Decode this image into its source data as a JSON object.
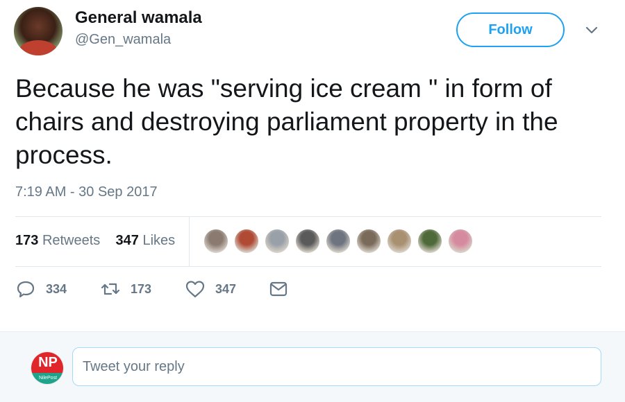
{
  "author": {
    "name": "General wamala",
    "handle": "@Gen_wamala"
  },
  "follow_label": "Follow",
  "tweet": {
    "text": "Because he was \"serving ice cream \" in form of chairs and destroying parliament property in the process.",
    "timestamp": "7:19 AM - 30 Sep 2017"
  },
  "stats": {
    "retweets_count": "173",
    "retweets_label": "Retweets",
    "likes_count": "347",
    "likes_label": "Likes"
  },
  "liker_colors": [
    "#8a7a70",
    "#b04a35",
    "#9aa0a8",
    "#5a5a5a",
    "#6e7480",
    "#7a6a5a",
    "#a89070",
    "#4f6a3a",
    "#d68aa0"
  ],
  "actions": {
    "reply_count": "334",
    "retweet_count": "173",
    "like_count": "347"
  },
  "reply": {
    "logo_text": "NP",
    "logo_subtext": "NilePost",
    "placeholder": "Tweet your reply"
  },
  "colors": {
    "accent": "#1da1f2",
    "muted": "#657786",
    "text": "#14171a"
  }
}
